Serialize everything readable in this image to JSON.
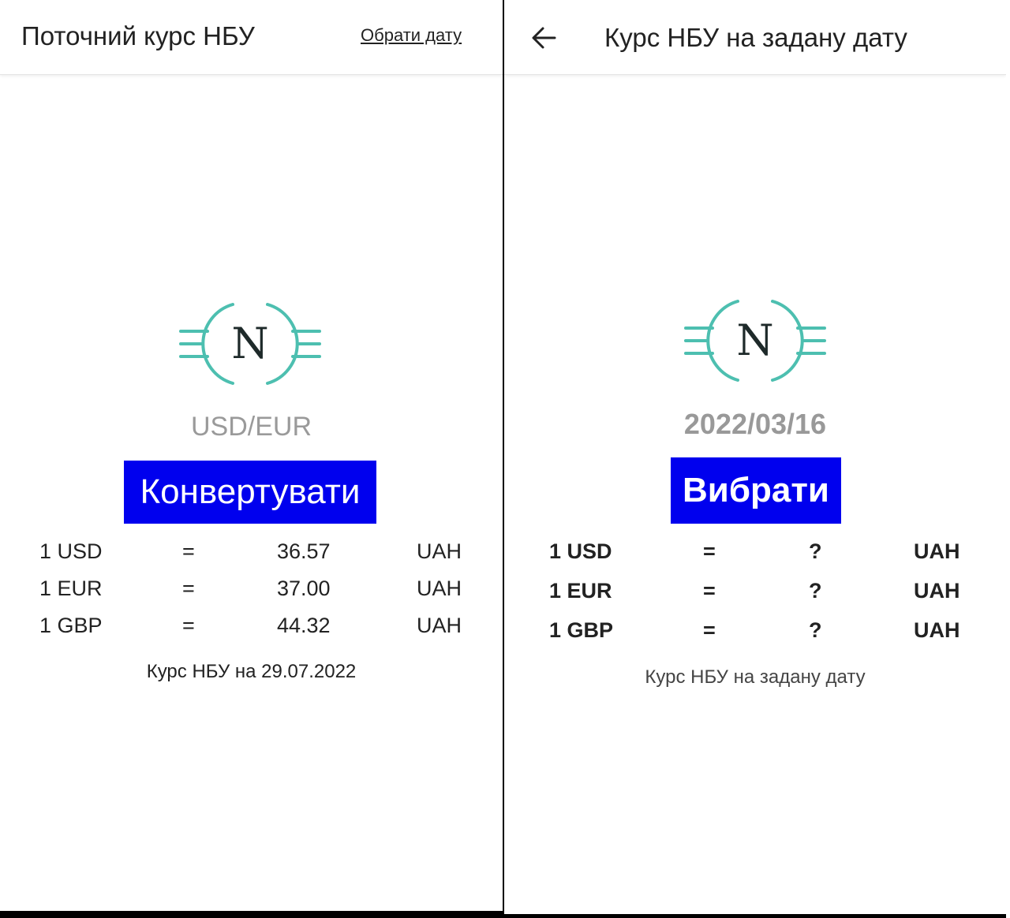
{
  "left_screen": {
    "title": "Поточний курс НБУ",
    "choose_date_link": "Обрати дату",
    "logo_letter": "N",
    "currency_pair": "USD/EUR",
    "convert_button": "Конвертувати",
    "rates": [
      {
        "currency": "1 USD",
        "eq": "=",
        "value": "36.57",
        "unit": "UAH"
      },
      {
        "currency": "1 EUR",
        "eq": "=",
        "value": "37.00",
        "unit": "UAH"
      },
      {
        "currency": "1 GBP",
        "eq": "=",
        "value": "44.32",
        "unit": "UAH"
      }
    ],
    "note": "Курс НБУ на 29.07.2022"
  },
  "right_screen": {
    "back_icon": "arrow-back-icon",
    "title": "Курс НБУ на задану дату",
    "logo_letter": "N",
    "date": "2022/03/16",
    "select_button": "Вибрати",
    "rates": [
      {
        "currency": "1 USD",
        "eq": "=",
        "value": "?",
        "unit": "UAH"
      },
      {
        "currency": "1 EUR",
        "eq": "=",
        "value": "?",
        "unit": "UAH"
      },
      {
        "currency": "1 GBP",
        "eq": "=",
        "value": "?",
        "unit": "UAH"
      }
    ],
    "note": "Курс НБУ на задану дату"
  },
  "colors": {
    "button_blue": "#0000ee",
    "logo_teal": "#4dbfb0",
    "subtle_gray": "#9a9a9a"
  }
}
